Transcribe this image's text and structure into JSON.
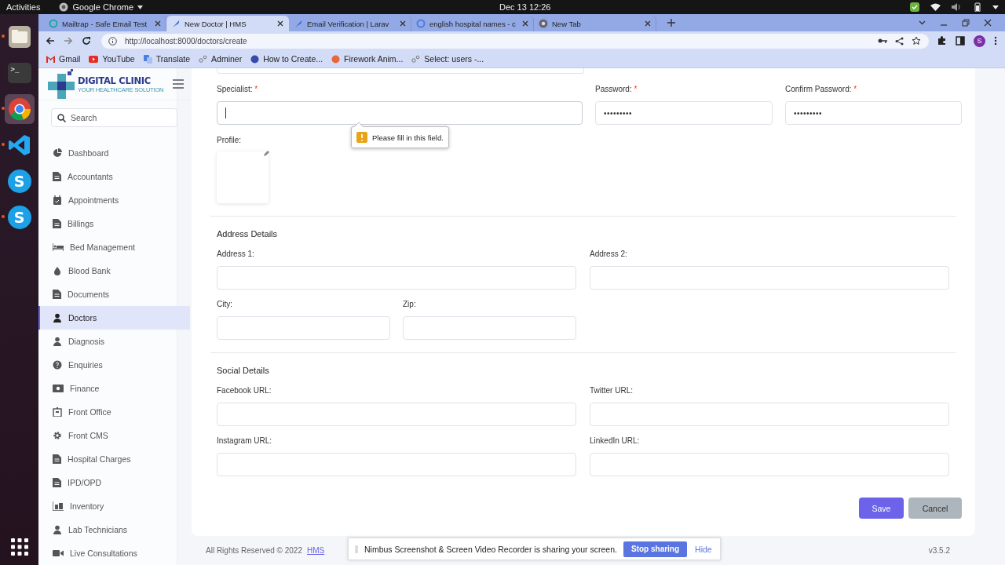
{
  "top_bar": {
    "activities": "Activities",
    "app_menu": "Google Chrome",
    "clock": "Dec 13  12:26"
  },
  "dock": [
    {
      "kind": "files",
      "running": true,
      "selected": false
    },
    {
      "kind": "terminal",
      "glyph": ">_",
      "running": false,
      "selected": false
    },
    {
      "kind": "chrome",
      "running": true,
      "selected": true
    },
    {
      "kind": "vscode",
      "running": true,
      "selected": false
    },
    {
      "kind": "skype",
      "glyph": "S",
      "running": false,
      "selected": false
    },
    {
      "kind": "skype",
      "glyph": "S",
      "running": true,
      "selected": false
    }
  ],
  "tabs": [
    {
      "title": "Mailtrap - Safe Email Test",
      "selected": false
    },
    {
      "title": "New Doctor | HMS",
      "selected": true
    },
    {
      "title": "Email Verification | Larav",
      "selected": false
    },
    {
      "title": "english hospital names - c",
      "selected": false
    },
    {
      "title": "New Tab",
      "selected": false
    }
  ],
  "address_bar": {
    "url": "http://localhost:8000/doctors/create"
  },
  "profile_initial": "S",
  "bookmarks": [
    "Gmail",
    "YouTube",
    "Translate",
    "Adminer",
    "How to Create...",
    "Firework Anim...",
    "Select: users -..."
  ],
  "sidebar": {
    "brand": "DIGITAL CLINIC",
    "tagline": "YOUR HEALTHCARE SOLUTION",
    "search": {
      "placeholder": "Search"
    },
    "items": [
      {
        "label": "Dashboard",
        "selected": false
      },
      {
        "label": "Accountants",
        "selected": false
      },
      {
        "label": "Appointments",
        "selected": false
      },
      {
        "label": "Billings",
        "selected": false
      },
      {
        "label": "Bed Management",
        "selected": false
      },
      {
        "label": "Blood Bank",
        "selected": false
      },
      {
        "label": "Documents",
        "selected": false
      },
      {
        "label": "Doctors",
        "selected": true
      },
      {
        "label": "Diagnosis",
        "selected": false
      },
      {
        "label": "Enquiries",
        "selected": false
      },
      {
        "label": "Finance",
        "selected": false
      },
      {
        "label": "Front Office",
        "selected": false
      },
      {
        "label": "Front CMS",
        "selected": false
      },
      {
        "label": "Hospital Charges",
        "selected": false
      },
      {
        "label": "IPD/OPD",
        "selected": false
      },
      {
        "label": "Inventory",
        "selected": false
      },
      {
        "label": "Lab Technicians",
        "selected": false
      },
      {
        "label": "Live Consultations",
        "selected": false
      }
    ]
  },
  "form": {
    "account_fields": [
      {
        "label": "Specialist:",
        "required": true,
        "focused": true
      },
      {
        "label": "Password:",
        "required": true,
        "value": "•••••••••",
        "focused": false
      },
      {
        "label": "Confirm Password:",
        "required": true,
        "value": "•••••••••",
        "focused": false
      }
    ],
    "required_mark": "*",
    "tooltip": "Please fill in this field.",
    "profile_label": "Profile:",
    "address_title": "Address Details",
    "address_fields": [
      {
        "label": "Address 1:"
      },
      {
        "label": "Address 2:"
      },
      {
        "label": "City:"
      },
      {
        "label": "Zip:"
      }
    ],
    "social_title": "Social Details",
    "social_fields": [
      {
        "label": "Facebook URL:"
      },
      {
        "label": "Twitter URL:"
      },
      {
        "label": "Instagram URL:"
      },
      {
        "label": "LinkedIn URL:"
      }
    ],
    "buttons": {
      "save": "Save",
      "cancel": "Cancel"
    }
  },
  "footer": {
    "copyright": "All Rights Reserved © 2022",
    "link": "HMS",
    "version": "v3.5.2"
  },
  "share_bar": {
    "message": "Nimbus Screenshot & Screen Video Recorder is sharing your screen.",
    "stop": "Stop sharing",
    "hide": "Hide"
  }
}
